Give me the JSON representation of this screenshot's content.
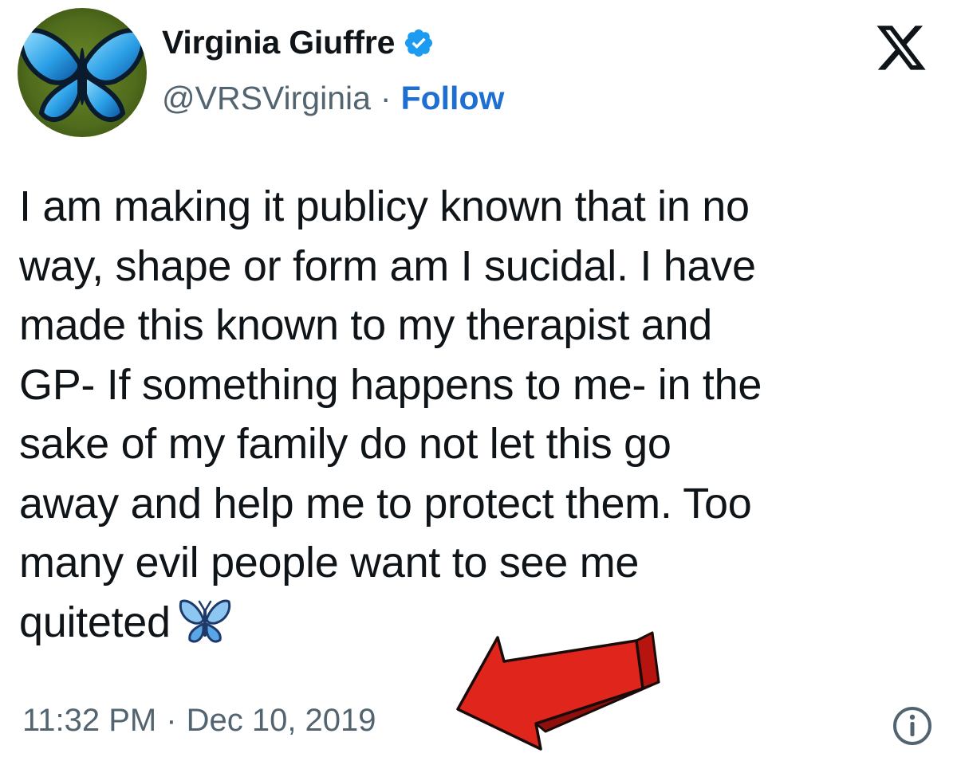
{
  "user": {
    "display_name": "Virginia Giuffre",
    "handle": "@VRSVirginia",
    "separator": "·",
    "follow_label": "Follow",
    "verified_icon": "verified-badge-icon",
    "avatar_icon": "blue-butterfly-avatar"
  },
  "brand": {
    "logo_icon": "x-logo-icon"
  },
  "tweet": {
    "lines": [
      "I am making it publicy known that in no",
      "way, shape or form am I sucidal. I have",
      "made this known to my therapist and",
      "GP- If something happens to me- in the",
      "sake of my family do not let this go",
      "away and help me to protect them. Too",
      "many evil people want to see me",
      "quiteted"
    ],
    "emoji_icon": "butterfly-emoji-icon"
  },
  "meta": {
    "time": "11:32 PM",
    "separator": "·",
    "date": "Dec 10, 2019",
    "info_icon": "info-icon"
  },
  "annotation": {
    "arrow_icon": "red-arrow-icon"
  },
  "colors": {
    "text": "#0f1419",
    "secondary": "#536471",
    "link": "#1d6fd1",
    "verified": "#1d9bf0",
    "arrow": "#e0261c"
  }
}
